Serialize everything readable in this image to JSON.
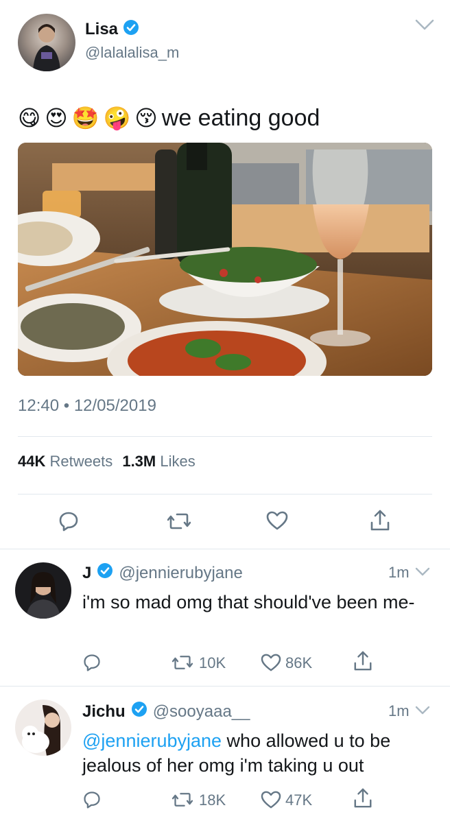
{
  "main_tweet": {
    "name": "Lisa",
    "handle": "@lalalalisa_m",
    "text": "we eating good",
    "emojis": [
      "😋",
      "😍",
      "🤩",
      "🤪",
      "😚"
    ],
    "time": "12:40",
    "separator": "•",
    "date": "12/05/2019",
    "retweets_count": "44K",
    "retweets_label": "Retweets",
    "likes_count": "1.3M",
    "likes_label": "Likes",
    "image_alt": "food-photo"
  },
  "replies": [
    {
      "name": "J",
      "handle": "@jennierubyjane",
      "time": "1m",
      "text": "i'm so mad omg that should've been me-",
      "mention": "",
      "retweets": "10K",
      "likes": "86K"
    },
    {
      "name": "Jichu",
      "handle": "@sooyaaa__",
      "time": "1m",
      "mention": "@jennierubyjane",
      "text": " who allowed u to be jealous of her omg i'm taking u out",
      "retweets": "18K",
      "likes": "47K"
    }
  ],
  "colors": {
    "accent": "#1da1f2",
    "text": "#14171a",
    "muted": "#657786",
    "divider": "#e1e8ed"
  }
}
